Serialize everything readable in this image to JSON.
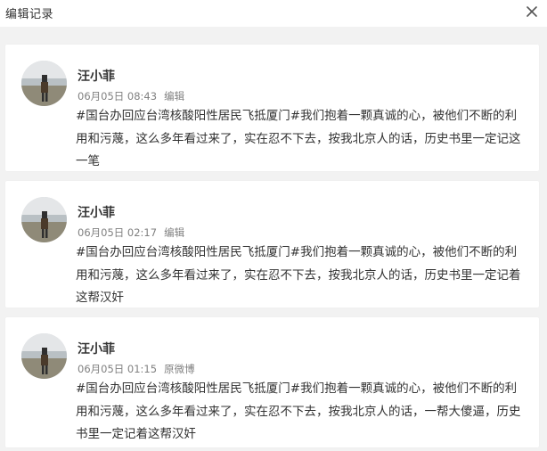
{
  "dialog": {
    "title": "编辑记录",
    "close_icon": "close-icon"
  },
  "records": [
    {
      "user": "汪小菲",
      "time": "06月05日 08:43",
      "source": "编辑",
      "text": "#国台办回应台湾核酸阳性居民飞抵厦门#我们抱着一颗真诚的心，被他们不断的利用和污蔑，这么多年看过来了，实在忍不下去，按我北京人的话，历史书里一定记这一笔"
    },
    {
      "user": "汪小菲",
      "time": "06月05日 02:17",
      "source": "编辑",
      "text": "#国台办回应台湾核酸阳性居民飞抵厦门#我们抱着一颗真诚的心，被他们不断的利用和污蔑，这么多年看过来了，实在忍不下去，按我北京人的话，历史书里一定记着这帮汉奸"
    },
    {
      "user": "汪小菲",
      "time": "06月05日 01:15",
      "source": "原微博",
      "text": "#国台办回应台湾核酸阳性居民飞抵厦门#我们抱着一颗真诚的心，被他们不断的利用和污蔑，这么多年看过来了，实在忍不下去，按我北京人的话，一帮大傻逼，历史书里一定记着这帮汉奸"
    }
  ]
}
